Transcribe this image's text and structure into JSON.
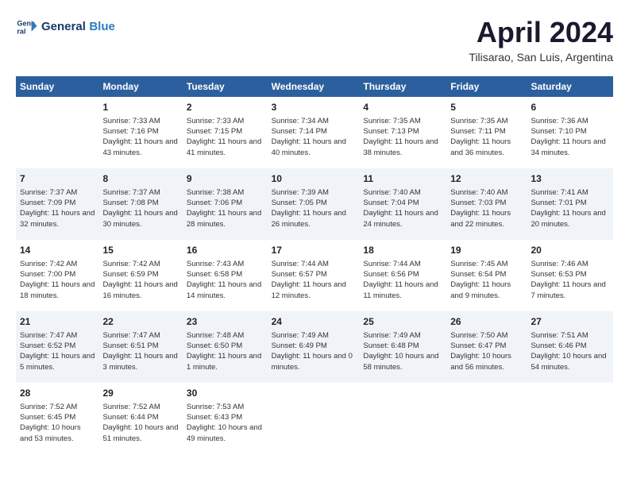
{
  "logo": {
    "line1": "General",
    "line2": "Blue"
  },
  "title": "April 2024",
  "subtitle": "Tilisarao, San Luis, Argentina",
  "days_of_week": [
    "Sunday",
    "Monday",
    "Tuesday",
    "Wednesday",
    "Thursday",
    "Friday",
    "Saturday"
  ],
  "weeks": [
    [
      {
        "num": "",
        "sunrise": "",
        "sunset": "",
        "daylight": ""
      },
      {
        "num": "1",
        "sunrise": "Sunrise: 7:33 AM",
        "sunset": "Sunset: 7:16 PM",
        "daylight": "Daylight: 11 hours and 43 minutes."
      },
      {
        "num": "2",
        "sunrise": "Sunrise: 7:33 AM",
        "sunset": "Sunset: 7:15 PM",
        "daylight": "Daylight: 11 hours and 41 minutes."
      },
      {
        "num": "3",
        "sunrise": "Sunrise: 7:34 AM",
        "sunset": "Sunset: 7:14 PM",
        "daylight": "Daylight: 11 hours and 40 minutes."
      },
      {
        "num": "4",
        "sunrise": "Sunrise: 7:35 AM",
        "sunset": "Sunset: 7:13 PM",
        "daylight": "Daylight: 11 hours and 38 minutes."
      },
      {
        "num": "5",
        "sunrise": "Sunrise: 7:35 AM",
        "sunset": "Sunset: 7:11 PM",
        "daylight": "Daylight: 11 hours and 36 minutes."
      },
      {
        "num": "6",
        "sunrise": "Sunrise: 7:36 AM",
        "sunset": "Sunset: 7:10 PM",
        "daylight": "Daylight: 11 hours and 34 minutes."
      }
    ],
    [
      {
        "num": "7",
        "sunrise": "Sunrise: 7:37 AM",
        "sunset": "Sunset: 7:09 PM",
        "daylight": "Daylight: 11 hours and 32 minutes."
      },
      {
        "num": "8",
        "sunrise": "Sunrise: 7:37 AM",
        "sunset": "Sunset: 7:08 PM",
        "daylight": "Daylight: 11 hours and 30 minutes."
      },
      {
        "num": "9",
        "sunrise": "Sunrise: 7:38 AM",
        "sunset": "Sunset: 7:06 PM",
        "daylight": "Daylight: 11 hours and 28 minutes."
      },
      {
        "num": "10",
        "sunrise": "Sunrise: 7:39 AM",
        "sunset": "Sunset: 7:05 PM",
        "daylight": "Daylight: 11 hours and 26 minutes."
      },
      {
        "num": "11",
        "sunrise": "Sunrise: 7:40 AM",
        "sunset": "Sunset: 7:04 PM",
        "daylight": "Daylight: 11 hours and 24 minutes."
      },
      {
        "num": "12",
        "sunrise": "Sunrise: 7:40 AM",
        "sunset": "Sunset: 7:03 PM",
        "daylight": "Daylight: 11 hours and 22 minutes."
      },
      {
        "num": "13",
        "sunrise": "Sunrise: 7:41 AM",
        "sunset": "Sunset: 7:01 PM",
        "daylight": "Daylight: 11 hours and 20 minutes."
      }
    ],
    [
      {
        "num": "14",
        "sunrise": "Sunrise: 7:42 AM",
        "sunset": "Sunset: 7:00 PM",
        "daylight": "Daylight: 11 hours and 18 minutes."
      },
      {
        "num": "15",
        "sunrise": "Sunrise: 7:42 AM",
        "sunset": "Sunset: 6:59 PM",
        "daylight": "Daylight: 11 hours and 16 minutes."
      },
      {
        "num": "16",
        "sunrise": "Sunrise: 7:43 AM",
        "sunset": "Sunset: 6:58 PM",
        "daylight": "Daylight: 11 hours and 14 minutes."
      },
      {
        "num": "17",
        "sunrise": "Sunrise: 7:44 AM",
        "sunset": "Sunset: 6:57 PM",
        "daylight": "Daylight: 11 hours and 12 minutes."
      },
      {
        "num": "18",
        "sunrise": "Sunrise: 7:44 AM",
        "sunset": "Sunset: 6:56 PM",
        "daylight": "Daylight: 11 hours and 11 minutes."
      },
      {
        "num": "19",
        "sunrise": "Sunrise: 7:45 AM",
        "sunset": "Sunset: 6:54 PM",
        "daylight": "Daylight: 11 hours and 9 minutes."
      },
      {
        "num": "20",
        "sunrise": "Sunrise: 7:46 AM",
        "sunset": "Sunset: 6:53 PM",
        "daylight": "Daylight: 11 hours and 7 minutes."
      }
    ],
    [
      {
        "num": "21",
        "sunrise": "Sunrise: 7:47 AM",
        "sunset": "Sunset: 6:52 PM",
        "daylight": "Daylight: 11 hours and 5 minutes."
      },
      {
        "num": "22",
        "sunrise": "Sunrise: 7:47 AM",
        "sunset": "Sunset: 6:51 PM",
        "daylight": "Daylight: 11 hours and 3 minutes."
      },
      {
        "num": "23",
        "sunrise": "Sunrise: 7:48 AM",
        "sunset": "Sunset: 6:50 PM",
        "daylight": "Daylight: 11 hours and 1 minute."
      },
      {
        "num": "24",
        "sunrise": "Sunrise: 7:49 AM",
        "sunset": "Sunset: 6:49 PM",
        "daylight": "Daylight: 11 hours and 0 minutes."
      },
      {
        "num": "25",
        "sunrise": "Sunrise: 7:49 AM",
        "sunset": "Sunset: 6:48 PM",
        "daylight": "Daylight: 10 hours and 58 minutes."
      },
      {
        "num": "26",
        "sunrise": "Sunrise: 7:50 AM",
        "sunset": "Sunset: 6:47 PM",
        "daylight": "Daylight: 10 hours and 56 minutes."
      },
      {
        "num": "27",
        "sunrise": "Sunrise: 7:51 AM",
        "sunset": "Sunset: 6:46 PM",
        "daylight": "Daylight: 10 hours and 54 minutes."
      }
    ],
    [
      {
        "num": "28",
        "sunrise": "Sunrise: 7:52 AM",
        "sunset": "Sunset: 6:45 PM",
        "daylight": "Daylight: 10 hours and 53 minutes."
      },
      {
        "num": "29",
        "sunrise": "Sunrise: 7:52 AM",
        "sunset": "Sunset: 6:44 PM",
        "daylight": "Daylight: 10 hours and 51 minutes."
      },
      {
        "num": "30",
        "sunrise": "Sunrise: 7:53 AM",
        "sunset": "Sunset: 6:43 PM",
        "daylight": "Daylight: 10 hours and 49 minutes."
      },
      {
        "num": "",
        "sunrise": "",
        "sunset": "",
        "daylight": ""
      },
      {
        "num": "",
        "sunrise": "",
        "sunset": "",
        "daylight": ""
      },
      {
        "num": "",
        "sunrise": "",
        "sunset": "",
        "daylight": ""
      },
      {
        "num": "",
        "sunrise": "",
        "sunset": "",
        "daylight": ""
      }
    ]
  ]
}
